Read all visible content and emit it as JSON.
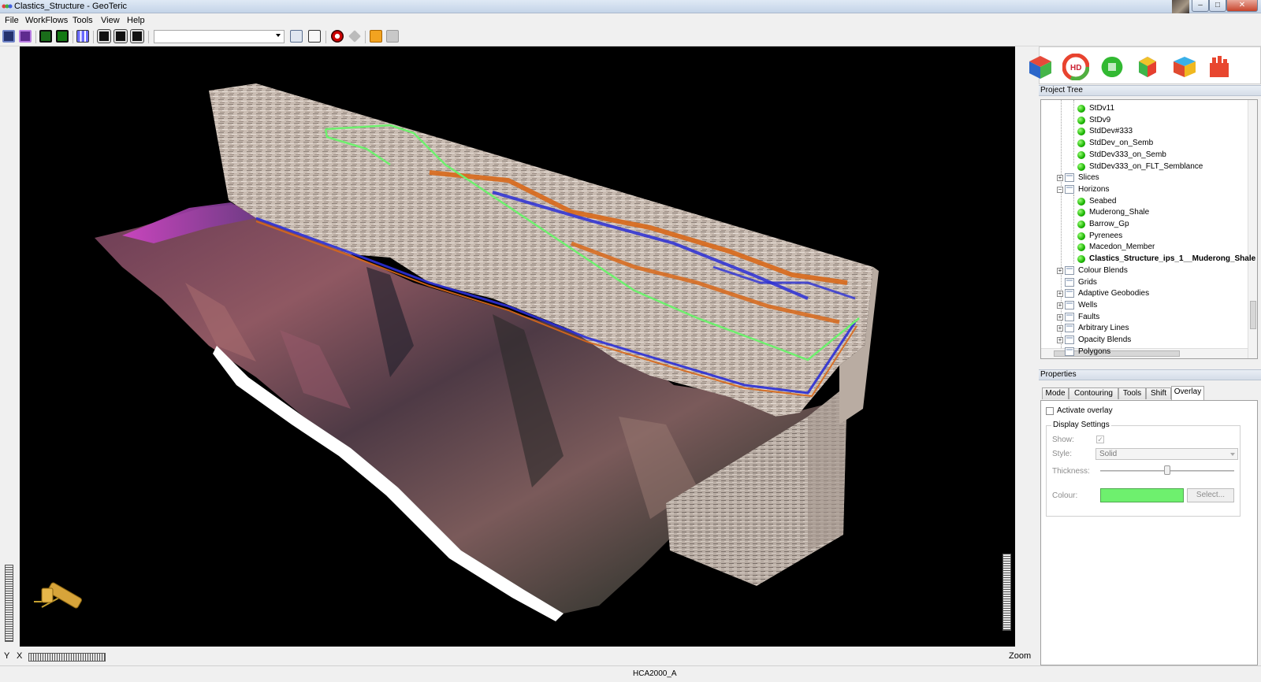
{
  "window": {
    "title": "Clastics_Structure - GeoTeric"
  },
  "menu": [
    "File",
    "WorkFlows",
    "Tools",
    "View",
    "Help"
  ],
  "toolbar": {
    "combo_value": ""
  },
  "viewport": {
    "axis_y": "Y",
    "axis_x": "X",
    "zoom_label": "Zoom"
  },
  "project_tree": {
    "header": "Project Tree",
    "items": [
      {
        "label": "StDv11",
        "type": "item"
      },
      {
        "label": "StDv9",
        "type": "item"
      },
      {
        "label": "StdDev#333",
        "type": "item"
      },
      {
        "label": "StdDev_on_Semb",
        "type": "item"
      },
      {
        "label": "StdDev333_on_Semb",
        "type": "item"
      },
      {
        "label": "StdDev333_on_FLT_Semblance",
        "type": "item"
      },
      {
        "label": "Slices",
        "type": "folder",
        "expander": "+"
      },
      {
        "label": "Horizons",
        "type": "folder",
        "expander": "−"
      },
      {
        "label": "Seabed",
        "type": "item"
      },
      {
        "label": "Muderong_Shale",
        "type": "item"
      },
      {
        "label": "Barrow_Gp",
        "type": "item"
      },
      {
        "label": "Pyrenees",
        "type": "item"
      },
      {
        "label": "Macedon_Member",
        "type": "item"
      },
      {
        "label": "Clastics_Structure_ips_1__Muderong_Shale",
        "type": "item",
        "bold": true
      },
      {
        "label": "Colour Blends",
        "type": "folder",
        "expander": "+"
      },
      {
        "label": "Grids",
        "type": "folder"
      },
      {
        "label": "Adaptive Geobodies",
        "type": "folder",
        "expander": "+"
      },
      {
        "label": "Wells",
        "type": "folder",
        "expander": "+"
      },
      {
        "label": "Faults",
        "type": "folder",
        "expander": "+"
      },
      {
        "label": "Arbitrary Lines",
        "type": "folder",
        "expander": "+"
      },
      {
        "label": "Opacity Blends",
        "type": "folder",
        "expander": "+"
      },
      {
        "label": "Polygons",
        "type": "folder"
      }
    ]
  },
  "properties": {
    "header": "Properties",
    "tabs": [
      "Mode",
      "Contouring",
      "Tools",
      "Shift",
      "Overlay"
    ],
    "active_tab": "Overlay",
    "activate_overlay": "Activate overlay",
    "display_settings": "Display Settings",
    "show_label": "Show:",
    "style_label": "Style:",
    "style_value": "Solid",
    "thickness_label": "Thickness:",
    "colour_label": "Colour:",
    "colour_value": "#6ef06e",
    "select_button": "Select..."
  },
  "status": {
    "text": "HCA2000_A"
  },
  "colors": {
    "overlay_line": "#6ef06e",
    "horizon_blue": "#2b2fd6",
    "horizon_orange": "#d8681a"
  }
}
